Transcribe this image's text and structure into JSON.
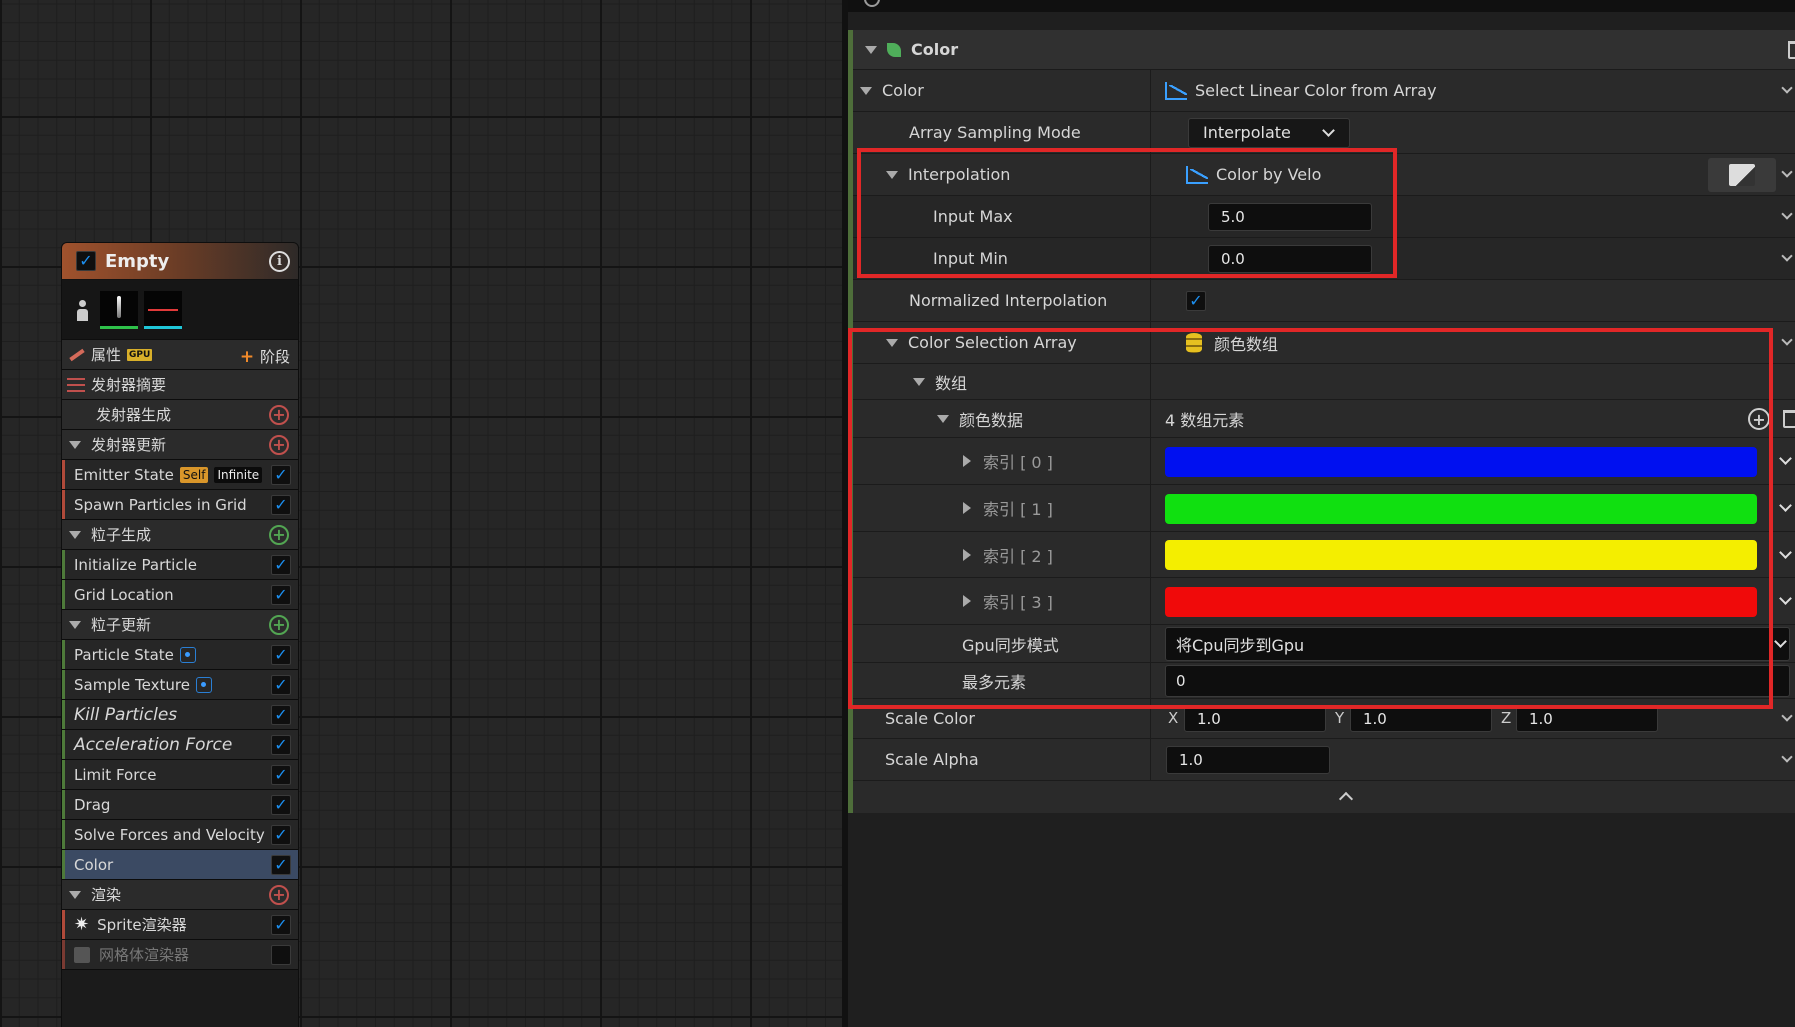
{
  "node": {
    "title": "Empty",
    "properties_label": "属性",
    "gpu_badge": "GPU",
    "add_stage_label": "阶段",
    "emitter_summary": "发射器摘要",
    "emitter_spawn": "发射器生成",
    "emitter_update": "发射器更新",
    "emitter_state": "Emitter State",
    "self_badge": "Self",
    "infinite_badge": "Infinite",
    "spawn_particles_grid": "Spawn Particles in Grid",
    "particle_spawn": "粒子生成",
    "initialize_particle": "Initialize Particle",
    "grid_location": "Grid Location",
    "particle_update": "粒子更新",
    "particle_state": "Particle State",
    "sample_texture": "Sample Texture",
    "kill_particles": "Kill Particles",
    "acceleration_force": "Acceleration Force",
    "limit_force": "Limit Force",
    "drag": "Drag",
    "solve_forces": "Solve Forces and Velocity",
    "color": "Color",
    "render": "渲染",
    "sprite_renderer": "Sprite渲染器",
    "mesh_renderer": "网格体渲染器"
  },
  "details": {
    "section_title": "Color",
    "color_label": "Color",
    "color_value": "Select Linear Color from Array",
    "array_sampling_label": "Array Sampling Mode",
    "array_sampling_value": "Interpolate",
    "interpolation_label": "Interpolation",
    "interpolation_value": "Color by Velo",
    "input_max_label": "Input Max",
    "input_max_value": "5.0",
    "input_min_label": "Input Min",
    "input_min_value": "0.0",
    "normalized_label": "Normalized Interpolation",
    "color_selection_label": "Color Selection Array",
    "color_selection_value": "颜色数组",
    "array_label": "数组",
    "color_data_label": "颜色数据",
    "color_data_count": "4 数组元素",
    "index_0": "索引 [ 0 ]",
    "index_1": "索引 [ 1 ]",
    "index_2": "索引 [ 2 ]",
    "index_3": "索引 [ 3 ]",
    "gpu_sync_label": "Gpu同步模式",
    "gpu_sync_value": "将Cpu同步到Gpu",
    "max_elements_label": "最多元素",
    "max_elements_value": "0",
    "scale_color_label": "Scale Color",
    "axis_x": "X",
    "axis_y": "Y",
    "axis_z": "Z",
    "scale_x": "1.0",
    "scale_y": "1.0",
    "scale_z": "1.0",
    "scale_alpha_label": "Scale Alpha",
    "scale_alpha_value": "1.0"
  },
  "colors": {
    "index_0": "#0010f0",
    "index_1": "#10e010",
    "index_2": "#f4ee00",
    "index_3": "#f00a0a",
    "highlight_box": "#e12727"
  }
}
